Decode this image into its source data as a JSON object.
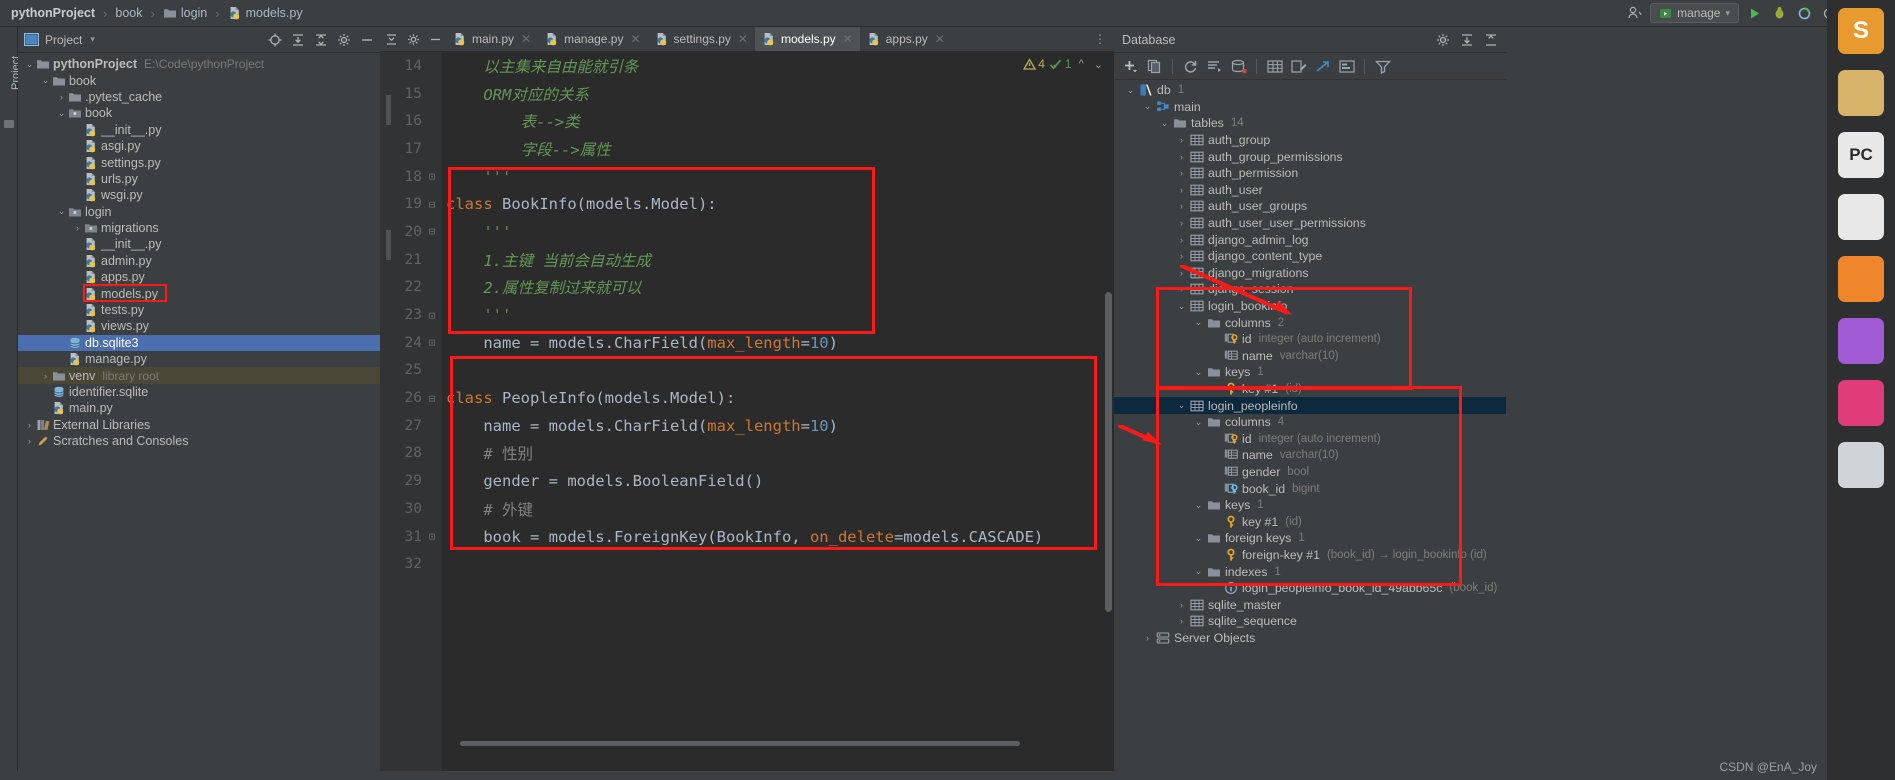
{
  "breadcrumb": [
    {
      "label": "pythonProject",
      "icon": "none",
      "bold": true
    },
    {
      "label": "book",
      "icon": "none",
      "bold": false
    },
    {
      "label": "login",
      "icon": "folder-icon",
      "bold": false
    },
    {
      "label": "models.py",
      "icon": "python-file-icon",
      "bold": false
    }
  ],
  "topbar": {
    "run_config": "manage",
    "user_icon": "user-icon",
    "run_icon": "run-icon",
    "debug_icon": "debug-icon",
    "coverage_icon": "coverage-icon",
    "profile_icon": "profile-icon",
    "more_icon": "more-icon",
    "search_icon": "search-icon"
  },
  "project_panel": {
    "vertical_label": "Project",
    "title": "Project",
    "icons": [
      "locate-icon",
      "expand-all-icon",
      "collapse-all-icon",
      "settings-icon",
      "hide-icon"
    ],
    "tree": [
      {
        "depth": 0,
        "arrow": "down",
        "icon": "folder-icon",
        "label": "pythonProject",
        "sub": "E:\\Code\\pythonProject",
        "bold": true,
        "state": "normal"
      },
      {
        "depth": 1,
        "arrow": "down",
        "icon": "folder-icon",
        "label": "book",
        "sub": "",
        "bold": false,
        "state": "normal"
      },
      {
        "depth": 2,
        "arrow": "right",
        "icon": "folder-icon",
        "label": ".pytest_cache",
        "sub": "",
        "bold": false,
        "state": "normal"
      },
      {
        "depth": 2,
        "arrow": "down",
        "icon": "module-icon",
        "label": "book",
        "sub": "",
        "bold": false,
        "state": "normal"
      },
      {
        "depth": 3,
        "arrow": "none",
        "icon": "python-file-icon",
        "label": "__init__.py",
        "sub": "",
        "bold": false,
        "state": "normal"
      },
      {
        "depth": 3,
        "arrow": "none",
        "icon": "python-file-icon",
        "label": "asgi.py",
        "sub": "",
        "bold": false,
        "state": "normal"
      },
      {
        "depth": 3,
        "arrow": "none",
        "icon": "python-file-icon",
        "label": "settings.py",
        "sub": "",
        "bold": false,
        "state": "normal"
      },
      {
        "depth": 3,
        "arrow": "none",
        "icon": "python-file-icon",
        "label": "urls.py",
        "sub": "",
        "bold": false,
        "state": "normal"
      },
      {
        "depth": 3,
        "arrow": "none",
        "icon": "python-file-icon",
        "label": "wsgi.py",
        "sub": "",
        "bold": false,
        "state": "normal"
      },
      {
        "depth": 2,
        "arrow": "down",
        "icon": "module-icon",
        "label": "login",
        "sub": "",
        "bold": false,
        "state": "normal"
      },
      {
        "depth": 3,
        "arrow": "right",
        "icon": "module-icon",
        "label": "migrations",
        "sub": "",
        "bold": false,
        "state": "normal"
      },
      {
        "depth": 3,
        "arrow": "none",
        "icon": "python-file-icon",
        "label": "__init__.py",
        "sub": "",
        "bold": false,
        "state": "normal"
      },
      {
        "depth": 3,
        "arrow": "none",
        "icon": "python-file-icon",
        "label": "admin.py",
        "sub": "",
        "bold": false,
        "state": "normal"
      },
      {
        "depth": 3,
        "arrow": "none",
        "icon": "python-file-icon",
        "label": "apps.py",
        "sub": "",
        "bold": false,
        "state": "normal"
      },
      {
        "depth": 3,
        "arrow": "none",
        "icon": "python-file-icon",
        "label": "models.py",
        "sub": "",
        "bold": false,
        "state": "highlighted"
      },
      {
        "depth": 3,
        "arrow": "none",
        "icon": "python-file-icon",
        "label": "tests.py",
        "sub": "",
        "bold": false,
        "state": "normal"
      },
      {
        "depth": 3,
        "arrow": "none",
        "icon": "python-file-icon",
        "label": "views.py",
        "sub": "",
        "bold": false,
        "state": "normal"
      },
      {
        "depth": 2,
        "arrow": "none",
        "icon": "database-file-icon",
        "label": "db.sqlite3",
        "sub": "",
        "bold": false,
        "state": "selected"
      },
      {
        "depth": 2,
        "arrow": "none",
        "icon": "python-file-icon",
        "label": "manage.py",
        "sub": "",
        "bold": false,
        "state": "normal"
      },
      {
        "depth": 1,
        "arrow": "right",
        "icon": "folder-icon",
        "label": "venv",
        "sub": "library root",
        "bold": false,
        "state": "venv"
      },
      {
        "depth": 1,
        "arrow": "none",
        "icon": "sqlite-file-icon",
        "label": "identifier.sqlite",
        "sub": "",
        "bold": false,
        "state": "normal"
      },
      {
        "depth": 1,
        "arrow": "none",
        "icon": "python-file-icon",
        "label": "main.py",
        "sub": "",
        "bold": false,
        "state": "normal"
      },
      {
        "depth": 0,
        "arrow": "right",
        "icon": "library-icon",
        "label": "External Libraries",
        "sub": "",
        "bold": false,
        "state": "normal"
      },
      {
        "depth": 0,
        "arrow": "right",
        "icon": "scratch-icon",
        "label": "Scratches and Consoles",
        "sub": "",
        "bold": false,
        "state": "normal"
      }
    ]
  },
  "editor": {
    "tabs": [
      {
        "label": "main.py",
        "active": false
      },
      {
        "label": "manage.py",
        "active": false
      },
      {
        "label": "settings.py",
        "active": false
      },
      {
        "label": "models.py",
        "active": true
      },
      {
        "label": "apps.py",
        "active": false
      }
    ],
    "inspections": {
      "warning_count": "4",
      "ok_count": "1"
    },
    "first_line_number": 14,
    "lines": [
      {
        "n": 14,
        "fold": "",
        "tokens": [
          {
            "t": "    以主集来自由能就引条",
            "c": "k-doc"
          }
        ]
      },
      {
        "n": 15,
        "fold": "",
        "tokens": [
          {
            "t": "    ORM对应的关系",
            "c": "k-doc"
          }
        ]
      },
      {
        "n": 16,
        "fold": "",
        "tokens": [
          {
            "t": "        表-->类",
            "c": "k-doc"
          }
        ]
      },
      {
        "n": 17,
        "fold": "",
        "tokens": [
          {
            "t": "        字段-->属性",
            "c": "k-doc"
          }
        ]
      },
      {
        "n": 18,
        "fold": "minus",
        "tokens": [
          {
            "t": "    '''",
            "c": "k-str"
          }
        ]
      },
      {
        "n": 19,
        "fold": "plus",
        "tokens": [
          {
            "t": "class ",
            "c": "k-kw"
          },
          {
            "t": "BookInfo",
            "c": "k-cls"
          },
          {
            "t": "(models.Model):",
            "c": "k-fn"
          }
        ]
      },
      {
        "n": 20,
        "fold": "plus",
        "tokens": [
          {
            "t": "    '''",
            "c": "k-str"
          }
        ]
      },
      {
        "n": 21,
        "fold": "",
        "tokens": [
          {
            "t": "    1.主键 当前会自动生成",
            "c": "k-doc"
          }
        ]
      },
      {
        "n": 22,
        "fold": "",
        "tokens": [
          {
            "t": "    2.属性复制过来就可以",
            "c": "k-doc"
          }
        ]
      },
      {
        "n": 23,
        "fold": "minus",
        "tokens": [
          {
            "t": "    '''",
            "c": "k-str"
          }
        ]
      },
      {
        "n": 24,
        "fold": "minus",
        "tokens": [
          {
            "t": "    name = models.CharField(",
            "c": "k-fn"
          },
          {
            "t": "max_length",
            "c": "k-par"
          },
          {
            "t": "=",
            "c": "k-fn"
          },
          {
            "t": "10",
            "c": "k-num"
          },
          {
            "t": ")",
            "c": "k-fn"
          }
        ]
      },
      {
        "n": 25,
        "fold": "",
        "tokens": [
          {
            "t": "",
            "c": "k-fn"
          }
        ]
      },
      {
        "n": 26,
        "fold": "plus",
        "tokens": [
          {
            "t": "class ",
            "c": "k-kw"
          },
          {
            "t": "PeopleInfo",
            "c": "k-cls"
          },
          {
            "t": "(models.Model):",
            "c": "k-fn"
          }
        ]
      },
      {
        "n": 27,
        "fold": "",
        "tokens": [
          {
            "t": "    name = models.CharField(",
            "c": "k-fn"
          },
          {
            "t": "max_length",
            "c": "k-par"
          },
          {
            "t": "=",
            "c": "k-fn"
          },
          {
            "t": "10",
            "c": "k-num"
          },
          {
            "t": ")",
            "c": "k-fn"
          }
        ]
      },
      {
        "n": 28,
        "fold": "",
        "tokens": [
          {
            "t": "    # 性别",
            "c": "k-cmt"
          }
        ]
      },
      {
        "n": 29,
        "fold": "",
        "tokens": [
          {
            "t": "    gender = models.BooleanField()",
            "c": "k-fn"
          }
        ]
      },
      {
        "n": 30,
        "fold": "",
        "tokens": [
          {
            "t": "    # 外键",
            "c": "k-cmt"
          }
        ]
      },
      {
        "n": 31,
        "fold": "minus",
        "tokens": [
          {
            "t": "    book = models.ForeignKey(BookInfo, ",
            "c": "k-fn"
          },
          {
            "t": "on_delete",
            "c": "k-par"
          },
          {
            "t": "=models.CASCADE)",
            "c": "k-fn"
          }
        ]
      },
      {
        "n": 32,
        "fold": "",
        "tokens": [
          {
            "t": "",
            "c": "k-fn"
          }
        ]
      }
    ]
  },
  "database": {
    "title": "Database",
    "head_icons": [
      "settings-icon",
      "expand-icon",
      "collapse-icon"
    ],
    "toolbar_icons": [
      "add-icon",
      "duplicate-icon",
      "refresh-icon",
      "query-console-icon",
      "sync-icon",
      "table-icon",
      "modify-icon",
      "jump-icon",
      "diagram-icon",
      "filter-icon"
    ],
    "tree": [
      {
        "depth": 0,
        "arrow": "down",
        "icon": "datasource-icon",
        "label": "db",
        "meta": "1",
        "box": "none",
        "state": "normal"
      },
      {
        "depth": 1,
        "arrow": "down",
        "icon": "schema-icon",
        "label": "main",
        "meta": "",
        "box": "none",
        "state": "normal"
      },
      {
        "depth": 2,
        "arrow": "down",
        "icon": "folder-icon",
        "label": "tables",
        "meta": "14",
        "box": "none",
        "state": "normal"
      },
      {
        "depth": 3,
        "arrow": "right",
        "icon": "table-icon",
        "label": "auth_group",
        "meta": "",
        "box": "none",
        "state": "normal"
      },
      {
        "depth": 3,
        "arrow": "right",
        "icon": "table-icon",
        "label": "auth_group_permissions",
        "meta": "",
        "box": "none",
        "state": "normal"
      },
      {
        "depth": 3,
        "arrow": "right",
        "icon": "table-icon",
        "label": "auth_permission",
        "meta": "",
        "box": "none",
        "state": "normal"
      },
      {
        "depth": 3,
        "arrow": "right",
        "icon": "table-icon",
        "label": "auth_user",
        "meta": "",
        "box": "none",
        "state": "normal"
      },
      {
        "depth": 3,
        "arrow": "right",
        "icon": "table-icon",
        "label": "auth_user_groups",
        "meta": "",
        "box": "none",
        "state": "normal"
      },
      {
        "depth": 3,
        "arrow": "right",
        "icon": "table-icon",
        "label": "auth_user_user_permissions",
        "meta": "",
        "box": "none",
        "state": "normal"
      },
      {
        "depth": 3,
        "arrow": "right",
        "icon": "table-icon",
        "label": "django_admin_log",
        "meta": "",
        "box": "none",
        "state": "normal"
      },
      {
        "depth": 3,
        "arrow": "right",
        "icon": "table-icon",
        "label": "django_content_type",
        "meta": "",
        "box": "none",
        "state": "normal"
      },
      {
        "depth": 3,
        "arrow": "right",
        "icon": "table-icon",
        "label": "django_migrations",
        "meta": "",
        "box": "none",
        "state": "normal"
      },
      {
        "depth": 3,
        "arrow": "right",
        "icon": "table-icon",
        "label": "django_session",
        "meta": "",
        "box": "none",
        "state": "normal"
      },
      {
        "depth": 3,
        "arrow": "down",
        "icon": "table-icon",
        "label": "login_bookinfo",
        "meta": "",
        "box": "start1",
        "state": "normal"
      },
      {
        "depth": 4,
        "arrow": "down",
        "icon": "folder-icon",
        "label": "columns",
        "meta": "2",
        "box": "in1",
        "state": "normal"
      },
      {
        "depth": 5,
        "arrow": "none",
        "icon": "pk-column-icon",
        "label": "id",
        "meta": "integer (auto increment)",
        "box": "in1",
        "state": "normal"
      },
      {
        "depth": 5,
        "arrow": "none",
        "icon": "column-icon",
        "label": "name",
        "meta": "varchar(10)",
        "box": "in1",
        "state": "normal"
      },
      {
        "depth": 4,
        "arrow": "down",
        "icon": "folder-icon",
        "label": "keys",
        "meta": "1",
        "box": "in1",
        "state": "normal"
      },
      {
        "depth": 5,
        "arrow": "none",
        "icon": "key-icon",
        "label": "key #1",
        "meta": "(id)",
        "box": "end1",
        "state": "normal"
      },
      {
        "depth": 3,
        "arrow": "down",
        "icon": "table-icon",
        "label": "login_peopleinfo",
        "meta": "",
        "box": "start2",
        "state": "selected"
      },
      {
        "depth": 4,
        "arrow": "down",
        "icon": "folder-icon",
        "label": "columns",
        "meta": "4",
        "box": "in2",
        "state": "normal"
      },
      {
        "depth": 5,
        "arrow": "none",
        "icon": "pk-column-icon",
        "label": "id",
        "meta": "integer (auto increment)",
        "box": "in2",
        "state": "normal"
      },
      {
        "depth": 5,
        "arrow": "none",
        "icon": "column-icon",
        "label": "name",
        "meta": "varchar(10)",
        "box": "in2",
        "state": "normal"
      },
      {
        "depth": 5,
        "arrow": "none",
        "icon": "column-icon",
        "label": "gender",
        "meta": "bool",
        "box": "in2",
        "state": "normal"
      },
      {
        "depth": 5,
        "arrow": "none",
        "icon": "fk-column-icon",
        "label": "book_id",
        "meta": "bigint",
        "box": "in2",
        "state": "normal"
      },
      {
        "depth": 4,
        "arrow": "down",
        "icon": "folder-icon",
        "label": "keys",
        "meta": "1",
        "box": "in2",
        "state": "normal"
      },
      {
        "depth": 5,
        "arrow": "none",
        "icon": "key-icon",
        "label": "key #1",
        "meta": "(id)",
        "box": "in2",
        "state": "normal"
      },
      {
        "depth": 4,
        "arrow": "down",
        "icon": "folder-icon",
        "label": "foreign keys",
        "meta": "1",
        "box": "in2",
        "state": "normal"
      },
      {
        "depth": 5,
        "arrow": "none",
        "icon": "key-icon",
        "label": "foreign-key #1",
        "meta": "(book_id) → login_bookinfo (id)",
        "box": "in2",
        "state": "normal"
      },
      {
        "depth": 4,
        "arrow": "down",
        "icon": "folder-icon",
        "label": "indexes",
        "meta": "1",
        "box": "in2",
        "state": "normal"
      },
      {
        "depth": 5,
        "arrow": "none",
        "icon": "index-icon",
        "label": "login_peopleinfo_book_id_49abb65c",
        "meta": "(book_id)",
        "box": "end2",
        "state": "normal"
      },
      {
        "depth": 3,
        "arrow": "right",
        "icon": "table-icon",
        "label": "sqlite_master",
        "meta": "",
        "box": "none",
        "state": "normal"
      },
      {
        "depth": 3,
        "arrow": "right",
        "icon": "table-icon",
        "label": "sqlite_sequence",
        "meta": "",
        "box": "none",
        "state": "normal"
      },
      {
        "depth": 1,
        "arrow": "right",
        "icon": "server-icon",
        "label": "Server Objects",
        "meta": "",
        "box": "none",
        "state": "normal"
      }
    ]
  },
  "taskbar": {
    "items": [
      {
        "name": "sublime-icon",
        "letter": "S",
        "color": "#e89a2f"
      },
      {
        "name": "file-explorer-icon",
        "letter": "",
        "color": "#d8b36a"
      },
      {
        "name": "pycharm-icon",
        "letter": "PC",
        "color": "#e8e8e8"
      },
      {
        "name": "chrome-icon",
        "letter": "",
        "color": "#e8e8e8"
      },
      {
        "name": "firefox-icon",
        "letter": "",
        "color": "#f0862b"
      },
      {
        "name": "app-purple-icon",
        "letter": "",
        "color": "#a05bd4"
      },
      {
        "name": "app-pink-icon",
        "letter": "",
        "color": "#e03c7a"
      },
      {
        "name": "recycle-bin-icon",
        "letter": "",
        "color": "#cfd4d8"
      }
    ]
  },
  "watermark": "CSDN @EnA_Joy"
}
